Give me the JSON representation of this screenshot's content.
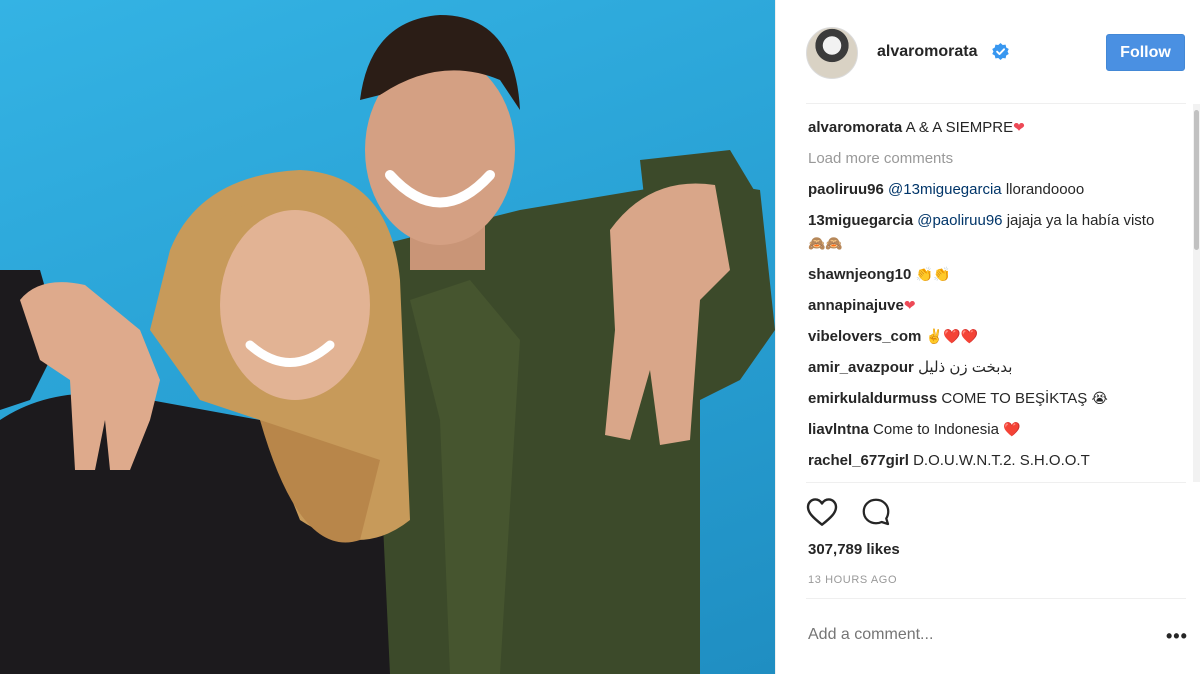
{
  "post": {
    "username": "alvaromorata",
    "follow_label": "Follow",
    "caption_user": "alvaromorata",
    "caption_text": "A & A SIEMPRE",
    "caption_emoji": "❤",
    "load_more": "Load more comments",
    "likes": "307,789 likes",
    "timestamp": "13 HOURS AGO",
    "add_comment_placeholder": "Add a comment...",
    "more_options": "•••"
  },
  "comments": [
    {
      "user": "paoliruu96",
      "mention": "@13miguegarcia",
      "text": "llorandoooo",
      "emoji": ""
    },
    {
      "user": "13miguegarcia",
      "mention": "@paoliruu96",
      "text": "jajaja ya la había visto",
      "emoji": "🙈🙈"
    },
    {
      "user": "shawnjeong10",
      "mention": "",
      "text": "",
      "emoji": "👏👏"
    },
    {
      "user": "annapinajuve",
      "mention": "",
      "text": "",
      "emoji": "❤"
    },
    {
      "user": "vibelovers_com",
      "mention": "",
      "text": "",
      "emoji": "✌️❤️❤️"
    },
    {
      "user": "amir_avazpour",
      "mention": "",
      "text": "بدبخت زن ذلیل",
      "emoji": ""
    },
    {
      "user": "emirkulaldurmuss",
      "mention": "",
      "text": "COME TO BEŞİKTAŞ",
      "emoji": "😭"
    },
    {
      "user": "liavlntna",
      "mention": "",
      "text": "Come to Indonesia",
      "emoji": "❤️"
    },
    {
      "user": "rachel_677girl",
      "mention": "",
      "text": "D.O.U.W.N.T.2. S.H.O.O.T",
      "emoji": ""
    }
  ],
  "icons": {
    "like": "heart-icon",
    "comment": "comment-bubble-icon",
    "verified": "verified-badge-icon"
  },
  "colors": {
    "follow_button": "#4a90e2",
    "verified": "#3897f0",
    "photo_background": "#2aa3d6"
  }
}
